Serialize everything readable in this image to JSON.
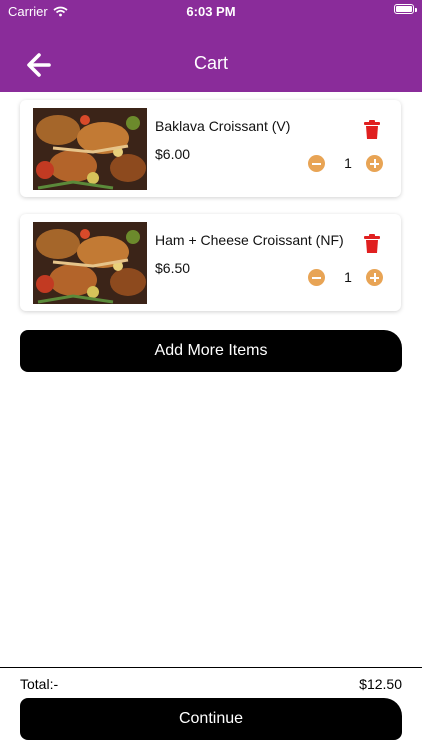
{
  "status_bar": {
    "carrier": "Carrier",
    "time": "6:03 PM"
  },
  "header": {
    "title": "Cart",
    "background_color": "#8a2c9a"
  },
  "cart": {
    "items": [
      {
        "name": "Baklava Croissant (V)",
        "price": "$6.00",
        "quantity": "1"
      },
      {
        "name": "Ham + Cheese Croissant (NF)",
        "price": "$6.50",
        "quantity": "1"
      }
    ]
  },
  "actions": {
    "add_more_label": "Add More Items",
    "continue_label": "Continue"
  },
  "summary": {
    "total_label": "Total:-",
    "total_value": "$12.50"
  },
  "colors": {
    "accent": "#e8a455",
    "delete": "#e02020",
    "button": "#000000"
  }
}
